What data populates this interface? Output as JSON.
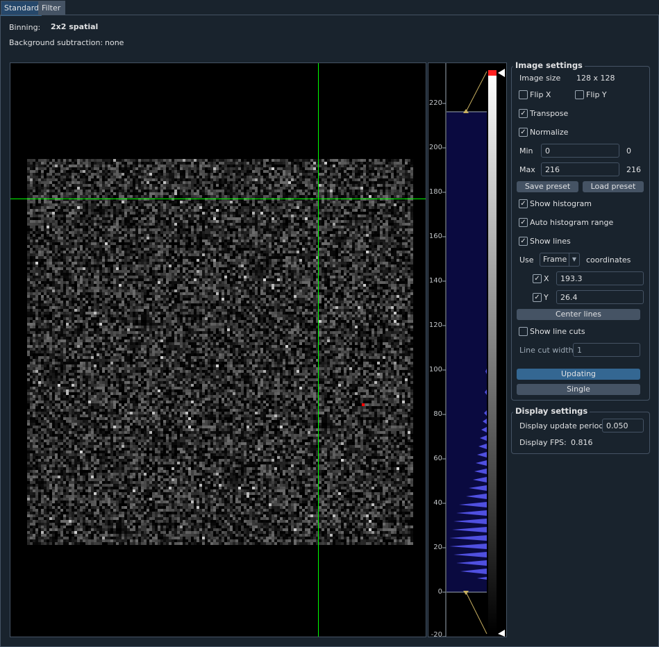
{
  "tabs": [
    {
      "label": "Standard",
      "active": true
    },
    {
      "label": "Filter",
      "active": false
    }
  ],
  "header": {
    "binning_label": "Binning:",
    "binning_value": "2x2 spatial",
    "bgsub_label": "Background subtraction:",
    "bgsub_value": "none"
  },
  "viewer": {
    "crosshair_color": "#00ff00",
    "marker_color": "#ff0000"
  },
  "histogram": {
    "axis_ticks": [
      "220",
      "200",
      "180",
      "160",
      "140",
      "120",
      "100",
      "80",
      "60",
      "40",
      "20",
      "0",
      "-20"
    ],
    "level_max": 216,
    "level_min": 0,
    "region_color": "#0a0a40",
    "histogram_color": "#5050e0"
  },
  "image_settings": {
    "title": "Image settings",
    "image_size_label": "Image size",
    "image_size_value": "128 x 128",
    "flip_x": {
      "label": "Flip X",
      "checked": false
    },
    "flip_y": {
      "label": "Flip Y",
      "checked": false
    },
    "transpose": {
      "label": "Transpose",
      "checked": true
    },
    "normalize": {
      "label": "Normalize",
      "checked": true
    },
    "min_label": "Min",
    "min_value": "0",
    "min_readout": "0",
    "max_label": "Max",
    "max_value": "216",
    "max_readout": "216",
    "save_preset": "Save preset",
    "load_preset": "Load preset",
    "show_histogram": {
      "label": "Show histogram",
      "checked": true
    },
    "auto_histogram_range": {
      "label": "Auto histogram range",
      "checked": true
    },
    "show_lines": {
      "label": "Show lines",
      "checked": true
    },
    "use_label": "Use",
    "coord_select": "Frame",
    "coordinates_label": "coordinates",
    "x_line": {
      "label": "X",
      "checked": true,
      "value": "193.3"
    },
    "y_line": {
      "label": "Y",
      "checked": true,
      "value": "26.4"
    },
    "center_lines": "Center lines",
    "show_line_cuts": {
      "label": "Show line cuts",
      "checked": false
    },
    "line_cut_width_label": "Line cut width",
    "line_cut_width_value": "1",
    "updating": "Updating",
    "single": "Single"
  },
  "display_settings": {
    "title": "Display settings",
    "update_period_label": "Display update period:",
    "update_period_value": "0.050",
    "fps_label": "Display FPS:",
    "fps_value": "0.816"
  }
}
